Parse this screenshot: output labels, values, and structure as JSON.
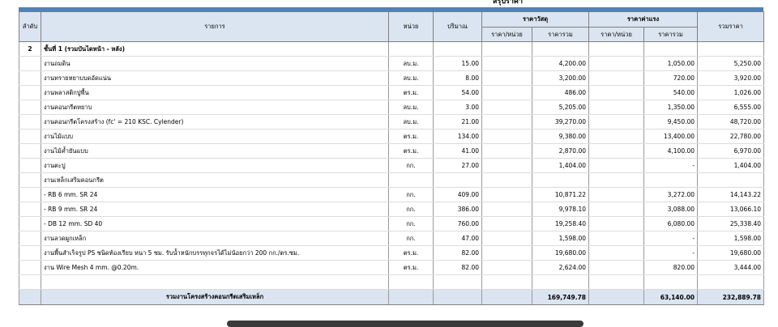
{
  "header": {
    "title": "สรุปราคา",
    "col_no": "ลำดับ",
    "col_item": "รายการ",
    "col_unit": "หน่วย",
    "col_qty": "ปริมาณ",
    "col_material": "ราคาวัสดุ",
    "col_labor": "ราคาค่าแรง",
    "col_total": "รวมราคา",
    "sub_unit_price": "ราคา/หน่วย",
    "sub_total": "ราคารวม"
  },
  "section": {
    "no": "2",
    "label": "ชั้นที่ 1 (รวมบันไดหน้า - หลัง)"
  },
  "rows": [
    {
      "item": "งานถมดิน",
      "unit": "ลบ.ม.",
      "qty": "15.00",
      "mat_total": "4,200.00",
      "lab_total": "1,050.00",
      "total": "5,250.00"
    },
    {
      "item": "งานทรายหยาบบดอัดแน่น",
      "unit": "ลบ.ม.",
      "qty": "8.00",
      "mat_total": "3,200.00",
      "lab_total": "720.00",
      "total": "3,920.00"
    },
    {
      "item": "งานพลาสติกปูพื้น",
      "unit": "ตร.ม.",
      "qty": "54.00",
      "mat_total": "486.00",
      "lab_total": "540.00",
      "total": "1,026.00"
    },
    {
      "item": "งานคอนกรีตหยาบ",
      "unit": "ลบ.ม.",
      "qty": "3.00",
      "mat_total": "5,205.00",
      "lab_total": "1,350.00",
      "total": "6,555.00"
    },
    {
      "item": "งานคอนกรีตโครงสร้าง (fc' = 210 KSC. Cylender)",
      "unit": "ลบ.ม.",
      "qty": "21.00",
      "mat_total": "39,270.00",
      "lab_total": "9,450.00",
      "total": "48,720.00"
    },
    {
      "item": "งานไม้แบบ",
      "unit": "ตร.ม.",
      "qty": "134.00",
      "mat_total": "9,380.00",
      "lab_total": "13,400.00",
      "total": "22,780.00"
    },
    {
      "item": "งานไม้ค้ำยันแบบ",
      "unit": "ตร.ม.",
      "qty": "41.00",
      "mat_total": "2,870.00",
      "lab_total": "4,100.00",
      "total": "6,970.00"
    },
    {
      "item": "งานตะปู",
      "unit": "กก.",
      "qty": "27.00",
      "mat_total": "1,404.00",
      "lab_total": "-",
      "total": "1,404.00"
    },
    {
      "item": "งานเหล็กเสริมคอนกรีต",
      "unit": "",
      "qty": "",
      "mat_total": "",
      "lab_total": "",
      "total": ""
    },
    {
      "item": "- RB 6 mm.  SR 24",
      "unit": "กก.",
      "qty": "409.00",
      "mat_total": "10,871.22",
      "lab_total": "3,272.00",
      "total": "14,143.22"
    },
    {
      "item": "- RB 9 mm.  SR 24",
      "unit": "กก.",
      "qty": "386.00",
      "mat_total": "9,978.10",
      "lab_total": "3,088.00",
      "total": "13,066.10"
    },
    {
      "item": "- DB 12 mm.  SD 40",
      "unit": "กก.",
      "qty": "760.00",
      "mat_total": "19,258.40",
      "lab_total": "6,080.00",
      "total": "25,338.40"
    },
    {
      "item": "งานลวดผูกเหล็ก",
      "unit": "กก.",
      "qty": "47.00",
      "mat_total": "1,598.00",
      "lab_total": "-",
      "total": "1,598.00"
    },
    {
      "item": "งานพื้นสำเร็จรูป PS ชนิดท้องเรียบ หนา 5 ซม. รับน้ำหนักบรรทุกจรได้ไม่น้อยกว่า 200 กก./ตร.ซม.",
      "unit": "ตร.ม.",
      "qty": "82.00",
      "mat_total": "19,680.00",
      "lab_total": "-",
      "total": "19,680.00"
    },
    {
      "item": "งาน Wire Mesh 4 mm. @0.20m.",
      "unit": "ตร.ม.",
      "qty": "82.00",
      "mat_total": "2,624.00",
      "lab_total": "820.00",
      "total": "3,444.00"
    }
  ],
  "footer": {
    "label": "รวมงานโครงสร้างคอนกรีตเสริมเหล็ก",
    "mat_total": "169,749.78",
    "lab_total": "63,140.00",
    "total": "232,889.78"
  },
  "colors": {
    "header_bg": "#dbe5f1",
    "band": "#4f81bd"
  }
}
